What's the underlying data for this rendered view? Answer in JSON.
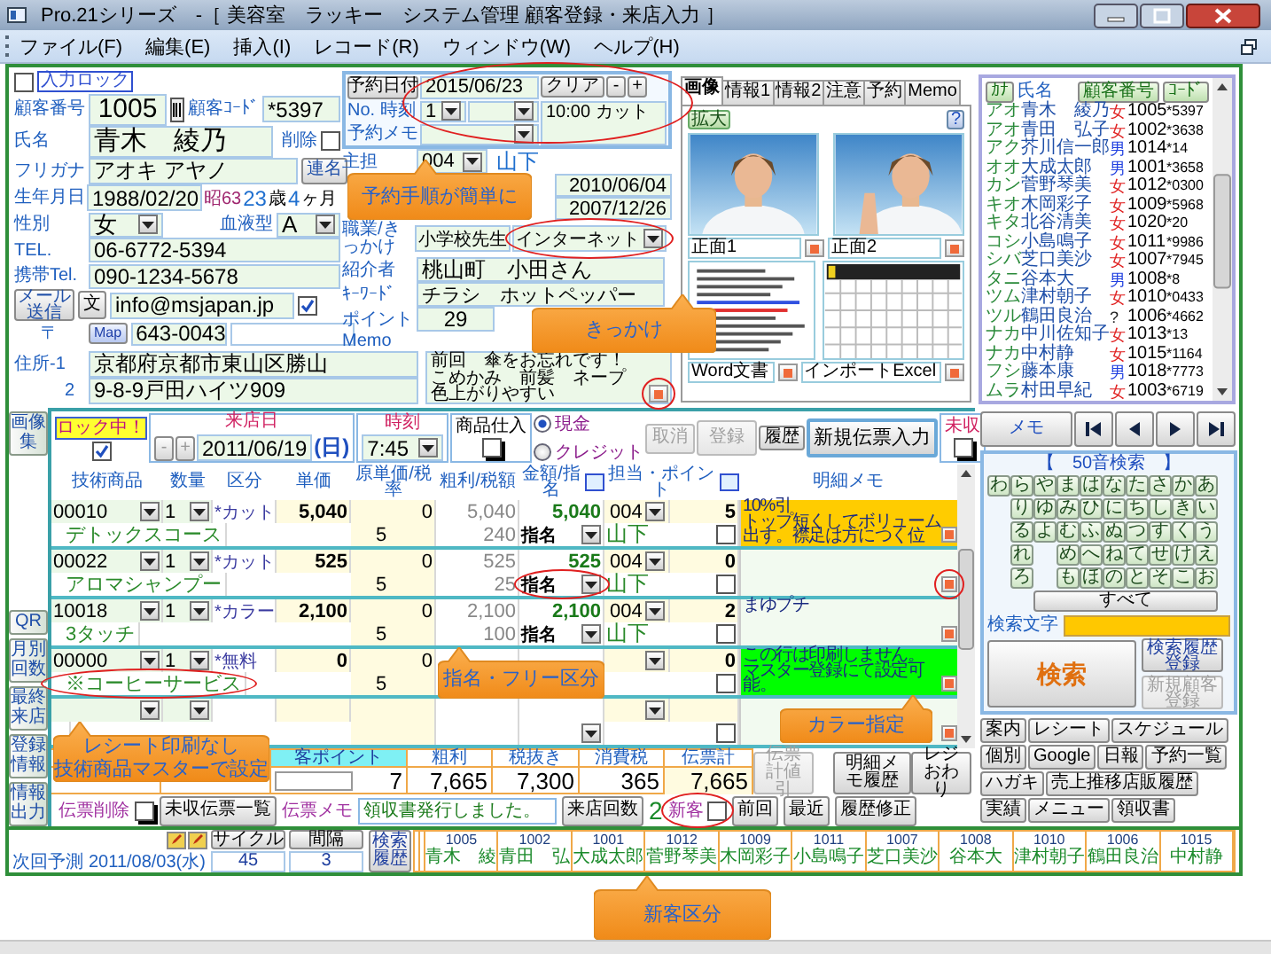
{
  "window": {
    "title": "Pro.21シリーズ　-［ 美容室　ラッキー　システム管理 顧客登録・来店入力 ］"
  },
  "menu": [
    "ファイル(F)",
    "編集(E)",
    "挿入(I)",
    "レコード(R)",
    "ウィンドウ(W)",
    "ヘルプ(H)"
  ],
  "customer": {
    "input_lock_label": "入力ロック",
    "input_lock": false,
    "no_label": "顧客番号",
    "no": "1005",
    "code_label": "顧客ｺｰﾄﾞ",
    "code": "*5397",
    "name_label": "氏名",
    "name": "青木　綾乃",
    "delete_label": "削除",
    "deleted": false,
    "kana_label": "フリガナ",
    "kana": "アオキ アヤノ",
    "joint_button": "連名",
    "birth_label": "生年月日",
    "birth": "1988/02/20",
    "era": "昭63",
    "age": "23",
    "age_unit": "歳",
    "months": "4",
    "months_unit": "ヶ月",
    "sex_label": "性別",
    "sex": "女",
    "blood_label": "血液型",
    "blood": "A",
    "tel_label": "TEL.",
    "tel": "06-6772-5394",
    "mobile_label": "携帯Tel.",
    "mobile": "090-1234-5678",
    "mail_button": "メール送信",
    "text_button": "文",
    "email": "info@msjapan.jp",
    "email_ok": true,
    "zip_label": "〒",
    "map_button": "Map",
    "zip": "643-0043",
    "addr1_label": "住所-1",
    "addr1": "京都府京都市東山区勝山",
    "addr2_label": "2",
    "addr2": "9-8-9戸田ハイツ909"
  },
  "reservation": {
    "date_button": "予約日付",
    "date": "2015/06/23",
    "clear_button": "クリア",
    "step_buttons": [
      "-",
      "+"
    ],
    "no_time_label": "No. 時刻",
    "no": "1",
    "note": "10:00 カット",
    "memo_label": "予約メモ"
  },
  "profile": {
    "staff_label": "主担",
    "staff_no": "004",
    "staff_name": "山下",
    "dates": [
      "2010/06/04",
      "2007/12/26"
    ],
    "job_label": "職業/きっかけ",
    "job": "小学校先生",
    "trigger": "インターネット",
    "referrer_label": "紹介者",
    "referrer": "桃山町　小田さん",
    "keyword_label": "ｷｰﾜｰﾄﾞ",
    "keyword": "チラシ　ホットペッパー",
    "point_label": "ポイント",
    "point": "29",
    "memo_label": "Memo",
    "memo_lines": [
      "前回　傘をお忘れです！",
      "こめかみ　前髪　ネープ",
      "色上がりやすい"
    ]
  },
  "photo_panel": {
    "tabs": [
      {
        "label": "画像",
        "selected": true
      },
      {
        "label": "情報1",
        "selected": false
      },
      {
        "label": "情報2",
        "selected": false
      },
      {
        "label": "注意",
        "selected": false
      },
      {
        "label": "予約",
        "selected": false
      },
      {
        "label": "Memo",
        "selected": false
      }
    ],
    "zoom_button": "拡大",
    "help_button": "?",
    "images": [
      {
        "caption": "正面1"
      },
      {
        "caption": "正面2"
      },
      {
        "caption": "Word文書",
        "kind": "document"
      },
      {
        "caption": "インポートExcel",
        "kind": "sheet"
      }
    ]
  },
  "customer_list": {
    "kana_button": "ｶﾅ",
    "name_header": "氏名",
    "no_button": "顧客番号",
    "code_button": "ｺｰﾄﾞ",
    "rows": [
      {
        "kana": "アオ",
        "name": "青木　綾乃",
        "sex": "女",
        "color": "#e02020",
        "no": "1005",
        "code": "*5397"
      },
      {
        "kana": "アオ",
        "name": "青田　弘子",
        "sex": "女",
        "color": "#e02020",
        "no": "1002",
        "code": "*3638"
      },
      {
        "kana": "アク",
        "name": "芥川信一郎",
        "sex": "男",
        "color": "#2040e0",
        "no": "1014",
        "code": "*14"
      },
      {
        "kana": "オオ",
        "name": "大成太郎",
        "sex": "男",
        "color": "#2040e0",
        "no": "1001",
        "code": "*3658"
      },
      {
        "kana": "カン",
        "name": "菅野琴美",
        "sex": "女",
        "color": "#e02020",
        "no": "1012",
        "code": "*0300"
      },
      {
        "kana": "キオ",
        "name": "木岡彩子",
        "sex": "女",
        "color": "#e02020",
        "no": "1009",
        "code": "*5968"
      },
      {
        "kana": "キタ",
        "name": "北谷清美",
        "sex": "女",
        "color": "#e02020",
        "no": "1020",
        "code": "*20"
      },
      {
        "kana": "コシ",
        "name": "小島鳴子",
        "sex": "女",
        "color": "#e02020",
        "no": "1011",
        "code": "*9986"
      },
      {
        "kana": "シバ",
        "name": "芝口美沙",
        "sex": "女",
        "color": "#e02020",
        "no": "1007",
        "code": "*7945"
      },
      {
        "kana": "タニ",
        "name": "谷本大",
        "sex": "男",
        "color": "#2040e0",
        "no": "1008",
        "code": "*8"
      },
      {
        "kana": "ツム",
        "name": "津村朝子",
        "sex": "女",
        "color": "#e02020",
        "no": "1010",
        "code": "*0433"
      },
      {
        "kana": "ツル",
        "name": "鶴田良治",
        "sex": "?",
        "color": "#202020",
        "no": "1006",
        "code": "*4662"
      },
      {
        "kana": "ナカ",
        "name": "中川佐知子",
        "sex": "女",
        "color": "#e02020",
        "no": "1013",
        "code": "*13"
      },
      {
        "kana": "ナカ",
        "name": "中村静",
        "sex": "女",
        "color": "#e02020",
        "no": "1015",
        "code": "*1164"
      },
      {
        "kana": "フシ",
        "name": "藤本康",
        "sex": "男",
        "color": "#2040e0",
        "no": "1018",
        "code": "*7773"
      },
      {
        "kana": "ムラ",
        "name": "村田早紀",
        "sex": "女",
        "color": "#e02020",
        "no": "1003",
        "code": "*6719"
      }
    ]
  },
  "side_tabs": [
    "画像集",
    "QR",
    "月別回数",
    "最終来店",
    "登録情報",
    "情報出力"
  ],
  "slip": {
    "lock_label": "ロック中！",
    "locked": true,
    "date_label": "来店日",
    "date_steps": [
      "-",
      "+"
    ],
    "date": "2011/06/19",
    "weekday": "(日)",
    "time_label": "時刻",
    "time": "7:45",
    "goods_label": "商品仕入",
    "goods": false,
    "payments": [
      {
        "label": "現金",
        "selected": true
      },
      {
        "label": "クレジット",
        "selected": false
      }
    ],
    "cancel_button": {
      "label": "取消",
      "disabled": true
    },
    "register_button": {
      "label": "登録",
      "disabled": true
    },
    "history_button": "履歴",
    "new_slip_button": "新規伝票入力",
    "unpaid_label": "未収",
    "unpaid": false,
    "columns": [
      "技術商品",
      "数量",
      "区分",
      "単価",
      "原単価/税率",
      "粗利/税額",
      "金額/指名",
      "担当・ポイント",
      "明細メモ"
    ],
    "items": [
      {
        "code": "00010",
        "qty": "1",
        "category": "*カット",
        "price": "5,040",
        "cost": "0",
        "profit": "5,040",
        "amount": "5,040",
        "staff_no": "004",
        "points": "5",
        "name": "デトックスコース",
        "tax_rate": "5",
        "tax": "240",
        "nomination": "指名",
        "staff_name": "山下",
        "checked": false,
        "memo_lines": [
          "10%引",
          "トップ短くしてボリューム出す。襟足は方につく位"
        ],
        "color": "#ffcc00"
      },
      {
        "code": "00022",
        "qty": "1",
        "category": "*カット",
        "price": "525",
        "cost": "0",
        "profit": "525",
        "amount": "525",
        "staff_no": "004",
        "points": "0",
        "name": "アロマシャンプー",
        "tax_rate": "5",
        "tax": "25",
        "nomination": "指名",
        "staff_name": "山下",
        "checked": false
      },
      {
        "code": "10018",
        "qty": "1",
        "category": "*カラー",
        "price": "2,100",
        "cost": "0",
        "profit": "2,100",
        "amount": "2,100",
        "staff_no": "004",
        "points": "2",
        "name": "3タッチ",
        "tax_rate": "5",
        "tax": "100",
        "nomination": "指名",
        "staff_name": "山下",
        "checked": false,
        "memo_lines": [
          "まゆプチ"
        ]
      },
      {
        "code": "00000",
        "qty": "1",
        "category": "*無料",
        "price": "0",
        "cost": "0",
        "points": "0",
        "name": "※コーヒーサービス",
        "tax_rate": "5",
        "checked": false,
        "memo_lines": [
          "この行は印刷しません。",
          "マスター登録にて設定可能。"
        ],
        "color": "#00ff00"
      },
      {
        "checked": false
      }
    ],
    "totals": {
      "point_label": "客ポイント",
      "point": "7",
      "profit_label": "粗利",
      "profit": "7,665",
      "net_label": "税抜き",
      "net": "7,300",
      "tax_label": "消費税",
      "tax": "365",
      "total_label": "伝票計",
      "total": "7,665",
      "discount_button": {
        "label": "伝票計値引",
        "disabled": true
      },
      "memo_history_button": "明細メモ履歴",
      "register_done_button": "レジおわり"
    },
    "delete_label": "伝票削除",
    "deleted": false,
    "unpaid_list_button": "未収伝票一覧",
    "memo_label": "伝票メモ",
    "memo": "領収書発行しました。",
    "visits_button": "来店回数",
    "visits": "2",
    "new_customer_label": "新客",
    "new_customer": false,
    "prev_button": "前回",
    "recent_button": "最近",
    "history_fix_button": "履歴修正"
  },
  "search_panel": {
    "memo_button": "メモ",
    "title": "【　50音検索　】",
    "kana_rows": [
      [
        {
          "kind": "key",
          "label": "わ"
        },
        {
          "kind": "key",
          "label": "ら"
        },
        {
          "kind": "key",
          "label": "や"
        },
        {
          "kind": "key",
          "label": "ま"
        },
        {
          "kind": "key",
          "label": "は"
        },
        {
          "kind": "key",
          "label": "な"
        },
        {
          "kind": "key",
          "label": "た"
        },
        {
          "kind": "key",
          "label": "さ"
        },
        {
          "kind": "key",
          "label": "か"
        },
        {
          "kind": "key",
          "label": "あ"
        }
      ],
      [
        {
          "kind": "gap"
        },
        {
          "kind": "key",
          "label": "り"
        },
        {
          "kind": "key",
          "label": "ゆ"
        },
        {
          "kind": "key",
          "label": "み"
        },
        {
          "kind": "key",
          "label": "ひ"
        },
        {
          "kind": "key",
          "label": "に"
        },
        {
          "kind": "key",
          "label": "ち"
        },
        {
          "kind": "key",
          "label": "し"
        },
        {
          "kind": "key",
          "label": "き"
        },
        {
          "kind": "key",
          "label": "い"
        }
      ],
      [
        {
          "kind": "gap"
        },
        {
          "kind": "key",
          "label": "る"
        },
        {
          "kind": "key",
          "label": "よ"
        },
        {
          "kind": "key",
          "label": "む"
        },
        {
          "kind": "key",
          "label": "ふ"
        },
        {
          "kind": "key",
          "label": "ぬ"
        },
        {
          "kind": "key",
          "label": "つ"
        },
        {
          "kind": "key",
          "label": "す"
        },
        {
          "kind": "key",
          "label": "く"
        },
        {
          "kind": "key",
          "label": "う"
        }
      ],
      [
        {
          "kind": "gap"
        },
        {
          "kind": "key",
          "label": "れ"
        },
        {
          "kind": "gap"
        },
        {
          "kind": "key",
          "label": "め"
        },
        {
          "kind": "key",
          "label": "へ"
        },
        {
          "kind": "key",
          "label": "ね"
        },
        {
          "kind": "key",
          "label": "て"
        },
        {
          "kind": "key",
          "label": "せ"
        },
        {
          "kind": "key",
          "label": "け"
        },
        {
          "kind": "key",
          "label": "え"
        }
      ],
      [
        {
          "kind": "gap"
        },
        {
          "kind": "key",
          "label": "ろ"
        },
        {
          "kind": "gap"
        },
        {
          "kind": "key",
          "label": "も"
        },
        {
          "kind": "key",
          "label": "ほ"
        },
        {
          "kind": "key",
          "label": "の"
        },
        {
          "kind": "key",
          "label": "と"
        },
        {
          "kind": "key",
          "label": "そ"
        },
        {
          "kind": "key",
          "label": "こ"
        },
        {
          "kind": "key",
          "label": "お"
        }
      ]
    ],
    "all_button": "すべて",
    "search_label": "検索文字",
    "search_button": "検索",
    "save_history_button": "検索履歴登録",
    "new_customer_button": {
      "label": "新規顧客登録",
      "disabled": true
    },
    "tools": [
      "案内",
      "レシート",
      "スケジュール",
      "個別",
      "Google",
      "日報",
      "予約一覧",
      "ハガキ",
      "売上推移店販履歴",
      "実績",
      "メニュー",
      "領収書"
    ]
  },
  "footer": {
    "cycle_button": "サイクル",
    "interval_button": "間隔",
    "next_label": "次回予測",
    "next_date": "2011/08/03(水)",
    "cycle": "45",
    "interval": "3",
    "search_history_button": "検索履歴",
    "history": [
      {
        "no": "1005",
        "name": "青木　綾"
      },
      {
        "no": "1002",
        "name": "青田　弘"
      },
      {
        "no": "1001",
        "name": "大成太郎"
      },
      {
        "no": "1012",
        "name": "菅野琴美"
      },
      {
        "no": "1009",
        "name": "木岡彩子"
      },
      {
        "no": "1011",
        "name": "小島鳴子"
      },
      {
        "no": "1007",
        "name": "芝口美沙"
      },
      {
        "no": "1008",
        "name": "谷本大"
      },
      {
        "no": "1010",
        "name": "津村朝子"
      },
      {
        "no": "1006",
        "name": "鶴田良治"
      },
      {
        "no": "1015",
        "name": "中村静"
      }
    ]
  },
  "callouts": [
    {
      "lines": [
        "予約手順が簡単に"
      ]
    },
    {
      "lines": [
        "きっかけ"
      ]
    },
    {
      "lines": [
        "指名・フリー区分"
      ]
    },
    {
      "lines": [
        "レシート印刷なし",
        "技術商品マスターで設定"
      ]
    },
    {
      "lines": [
        "カラー指定"
      ]
    },
    {
      "lines": [
        "新客区分"
      ]
    }
  ]
}
